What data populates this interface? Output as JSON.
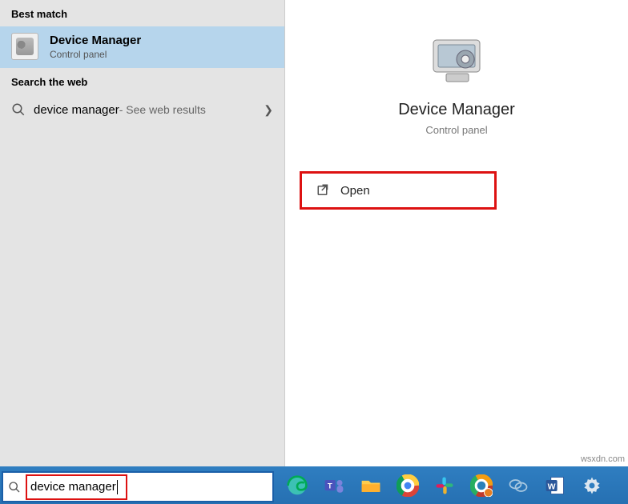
{
  "sections": {
    "best_match": "Best match",
    "search_web": "Search the web"
  },
  "best_match_item": {
    "title": "Device Manager",
    "subtitle": "Control panel"
  },
  "web_result": {
    "query": "device manager",
    "suffix": " - See web results"
  },
  "detail": {
    "title": "Device Manager",
    "subtitle": "Control panel",
    "open": "Open"
  },
  "search_input": {
    "value": "device manager"
  },
  "watermark": "wsxdn.com",
  "taskbar_icons": [
    "edge",
    "teams",
    "file-explorer",
    "chrome",
    "slack",
    "chrome-beta",
    "skype",
    "word",
    "settings"
  ]
}
